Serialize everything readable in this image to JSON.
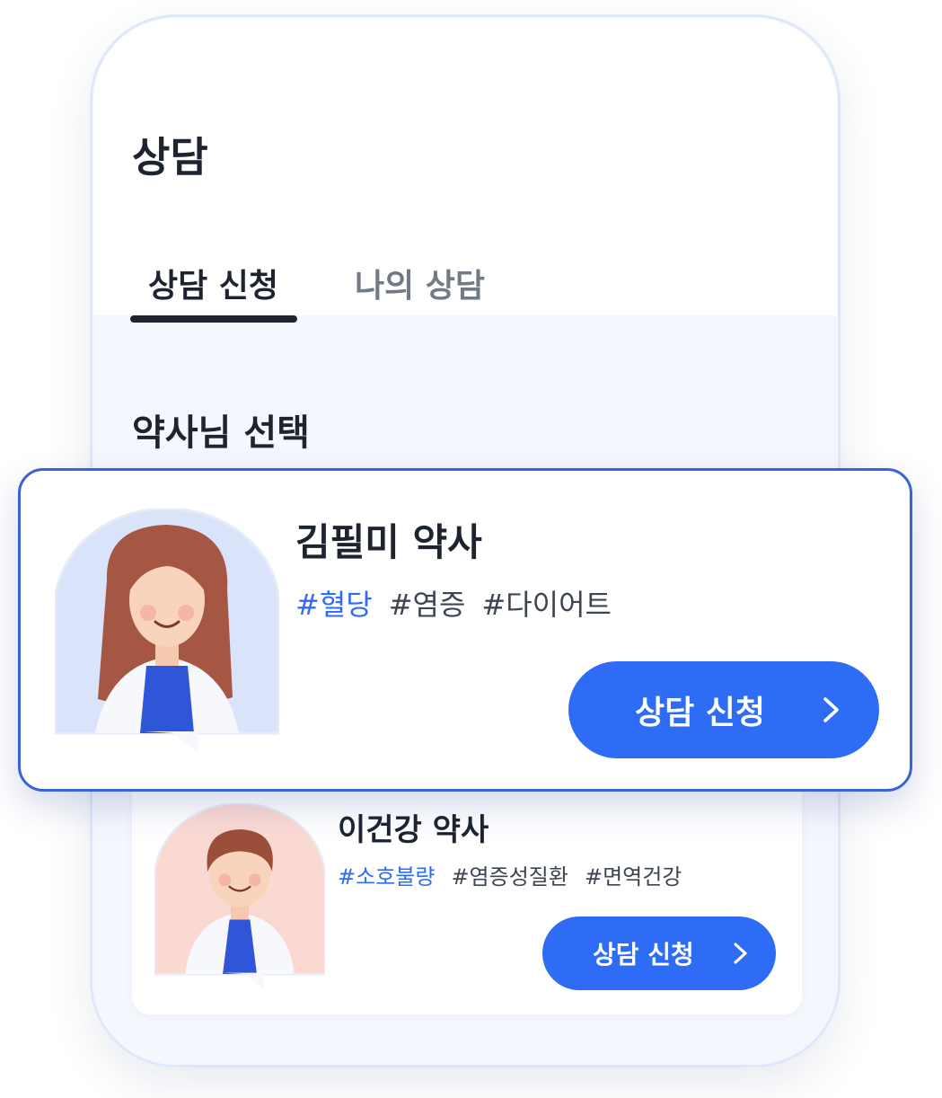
{
  "header": {
    "title": "상담"
  },
  "tabs": [
    {
      "label": "상담 신청",
      "active": true
    },
    {
      "label": "나의 상담",
      "active": false
    }
  ],
  "section": {
    "title": "약사님 선택"
  },
  "pharmacists": [
    {
      "name": "김필미 약사",
      "tags": [
        "#혈당",
        "#염증",
        "#다이어트"
      ],
      "button_label": "상담 신청"
    },
    {
      "name": "이건강 약사",
      "tags": [
        "#소호불량",
        "#염증성질환",
        "#면역건강"
      ],
      "button_label": "상담 신청"
    }
  ],
  "icons": {
    "button_chevron": "chevron-right-icon"
  },
  "colors": {
    "primary": "#2f6cf6",
    "text_dark": "#1d2430",
    "text_gray": "#727a87",
    "card_border": "#3a63d6"
  }
}
